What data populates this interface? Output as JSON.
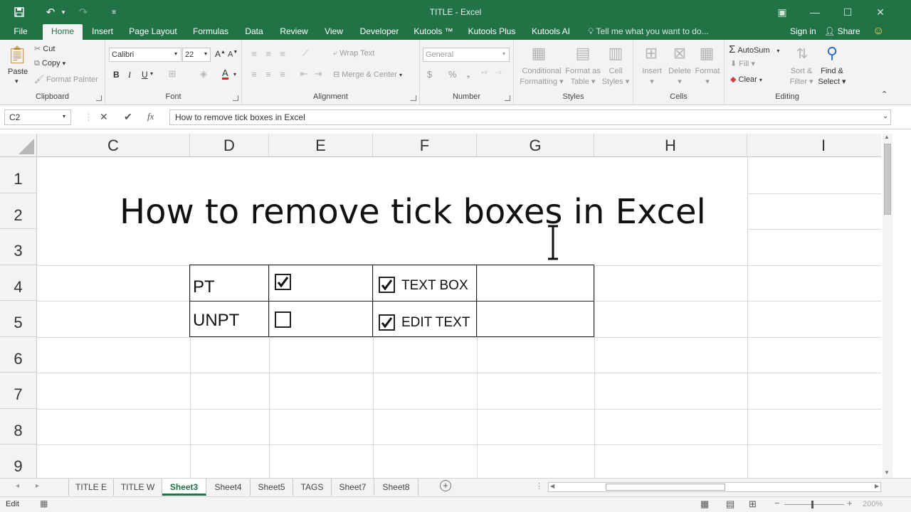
{
  "window": {
    "title": "TITLE - Excel"
  },
  "tabs": [
    "File",
    "Home",
    "Insert",
    "Page Layout",
    "Formulas",
    "Data",
    "Review",
    "View",
    "Developer",
    "Kutools ™",
    "Kutools Plus",
    "Kutools AI"
  ],
  "tell_me": "Tell me what you want to do...",
  "sign_in": "Sign in",
  "share": "Share",
  "ribbon": {
    "clipboard": {
      "paste": "Paste",
      "cut": "Cut",
      "copy": "Copy",
      "format_painter": "Format Painter",
      "label": "Clipboard"
    },
    "font": {
      "name": "Calibri",
      "size": "22",
      "bold": "B",
      "italic": "I",
      "underline": "U",
      "label": "Font"
    },
    "alignment": {
      "wrap": "Wrap Text",
      "merge": "Merge & Center",
      "label": "Alignment"
    },
    "number": {
      "format": "General",
      "currency": "$",
      "percent": "%",
      "label": "Number"
    },
    "styles": {
      "conditional_1": "Conditional",
      "conditional_2": "Formatting",
      "format_table_1": "Format as",
      "format_table_2": "Table",
      "cell_styles_1": "Cell",
      "cell_styles_2": "Styles",
      "label": "Styles"
    },
    "cells": {
      "insert": "Insert",
      "delete": "Delete",
      "format": "Format",
      "label": "Cells"
    },
    "editing": {
      "autosum": "AutoSum",
      "fill": "Fill",
      "clear": "Clear",
      "sort_1": "Sort &",
      "sort_2": "Filter",
      "find_1": "Find &",
      "find_2": "Select",
      "label": "Editing"
    }
  },
  "formula_bar": {
    "name_box": "C2",
    "cancel": "✕",
    "enter": "✔",
    "fx": "fx",
    "content": "How to remove tick boxes in Excel"
  },
  "grid": {
    "columns": [
      "C",
      "D",
      "E",
      "F",
      "G",
      "H",
      "I"
    ],
    "rows": [
      "1",
      "2",
      "3",
      "4",
      "5",
      "6",
      "7",
      "8",
      "9"
    ],
    "title": "How to remove tick boxes in Excel",
    "d4": "PT",
    "d5": "UNPT",
    "f4_label": "TEXT BOX",
    "f5_label": "EDIT TEXT",
    "checkboxes": {
      "e4": true,
      "e5": false,
      "f4": true,
      "f5": true
    }
  },
  "sheets": [
    "TITLE E",
    "TITLE W",
    "Sheet3",
    "Sheet4",
    "Sheet5",
    "TAGS",
    "Sheet7",
    "Sheet8"
  ],
  "active_sheet": "Sheet3",
  "status": {
    "mode": "Edit",
    "zoom": "200%"
  },
  "colors": {
    "accent": "#217346"
  }
}
